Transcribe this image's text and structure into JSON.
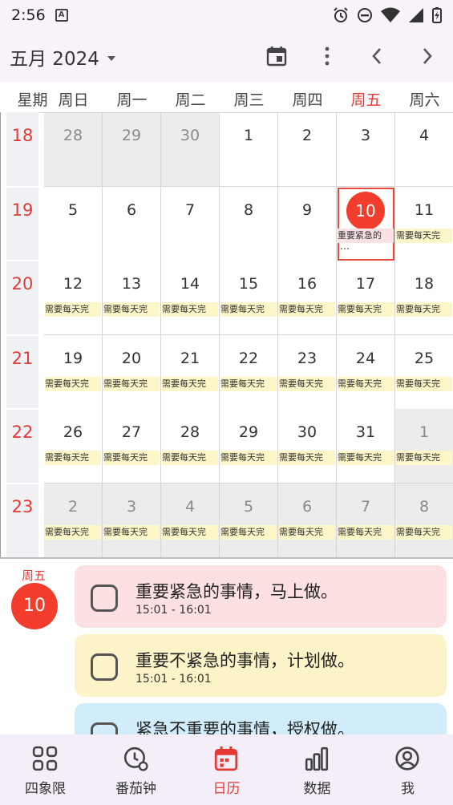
{
  "status_bar": {
    "time": "2:56",
    "notification_icon": "A"
  },
  "header": {
    "title": "五月 2024"
  },
  "weekdays": {
    "label": "星期",
    "days": [
      "周日",
      "周一",
      "周二",
      "周三",
      "周四",
      "周五",
      "周六"
    ],
    "highlight_index": 5
  },
  "calendar": {
    "weeks": [
      {
        "number": "18",
        "days": [
          {
            "d": "28",
            "out": true
          },
          {
            "d": "29",
            "out": true
          },
          {
            "d": "30",
            "out": true
          },
          {
            "d": "1"
          },
          {
            "d": "2"
          },
          {
            "d": "3"
          },
          {
            "d": "4"
          }
        ]
      },
      {
        "number": "19",
        "days": [
          {
            "d": "5"
          },
          {
            "d": "6"
          },
          {
            "d": "7"
          },
          {
            "d": "8"
          },
          {
            "d": "9"
          },
          {
            "d": "10",
            "today": true,
            "tag": "重要紧急的",
            "tag_color": "red",
            "more": "…"
          },
          {
            "d": "11",
            "tag": "需要每天完"
          }
        ]
      },
      {
        "number": "20",
        "days": [
          {
            "d": "12",
            "tag": "需要每天完"
          },
          {
            "d": "13",
            "tag": "需要每天完"
          },
          {
            "d": "14",
            "tag": "需要每天完"
          },
          {
            "d": "15",
            "tag": "需要每天完"
          },
          {
            "d": "16",
            "tag": "需要每天完"
          },
          {
            "d": "17",
            "tag": "需要每天完"
          },
          {
            "d": "18",
            "tag": "需要每天完"
          }
        ]
      },
      {
        "number": "21",
        "days": [
          {
            "d": "19",
            "tag": "需要每天完"
          },
          {
            "d": "20",
            "tag": "需要每天完"
          },
          {
            "d": "21",
            "tag": "需要每天完"
          },
          {
            "d": "22",
            "tag": "需要每天完"
          },
          {
            "d": "23",
            "tag": "需要每天完"
          },
          {
            "d": "24",
            "tag": "需要每天完"
          },
          {
            "d": "25",
            "tag": "需要每天完"
          }
        ]
      },
      {
        "number": "22",
        "days": [
          {
            "d": "26",
            "tag": "需要每天完"
          },
          {
            "d": "27",
            "tag": "需要每天完"
          },
          {
            "d": "28",
            "tag": "需要每天完"
          },
          {
            "d": "29",
            "tag": "需要每天完"
          },
          {
            "d": "30",
            "tag": "需要每天完"
          },
          {
            "d": "31",
            "tag": "需要每天完"
          },
          {
            "d": "1",
            "out": true,
            "tag": "需要每天完"
          }
        ]
      },
      {
        "number": "23",
        "days": [
          {
            "d": "2",
            "out": true,
            "tag": "需要每天完"
          },
          {
            "d": "3",
            "out": true,
            "tag": "需要每天完"
          },
          {
            "d": "4",
            "out": true,
            "tag": "需要每天完"
          },
          {
            "d": "5",
            "out": true,
            "tag": "需要每天完"
          },
          {
            "d": "6",
            "out": true,
            "tag": "需要每天完"
          },
          {
            "d": "7",
            "out": true,
            "tag": "需要每天完"
          },
          {
            "d": "8",
            "out": true,
            "tag": "需要每天完"
          }
        ]
      }
    ]
  },
  "agenda": {
    "weekday": "周五",
    "day": "10",
    "tasks": [
      {
        "title": "重要紧急的事情，马上做。",
        "time": "15:01 - 16:01",
        "color": "#fde0e1"
      },
      {
        "title": "重要不紧急的事情，计划做。",
        "time": "15:01 - 16:01",
        "color": "#fdf3c8"
      },
      {
        "title": "紧急不重要的事情，授权做。",
        "time": "",
        "color": "#d1edfb"
      }
    ]
  },
  "bottom_nav": {
    "items": [
      {
        "label": "四象限",
        "icon": "grid-icon"
      },
      {
        "label": "番茄钟",
        "icon": "clock-icon"
      },
      {
        "label": "日历",
        "icon": "calendar-icon",
        "active": true
      },
      {
        "label": "数据",
        "icon": "bar-chart-icon"
      },
      {
        "label": "我",
        "icon": "profile-icon"
      }
    ],
    "accent": "#e53935"
  }
}
